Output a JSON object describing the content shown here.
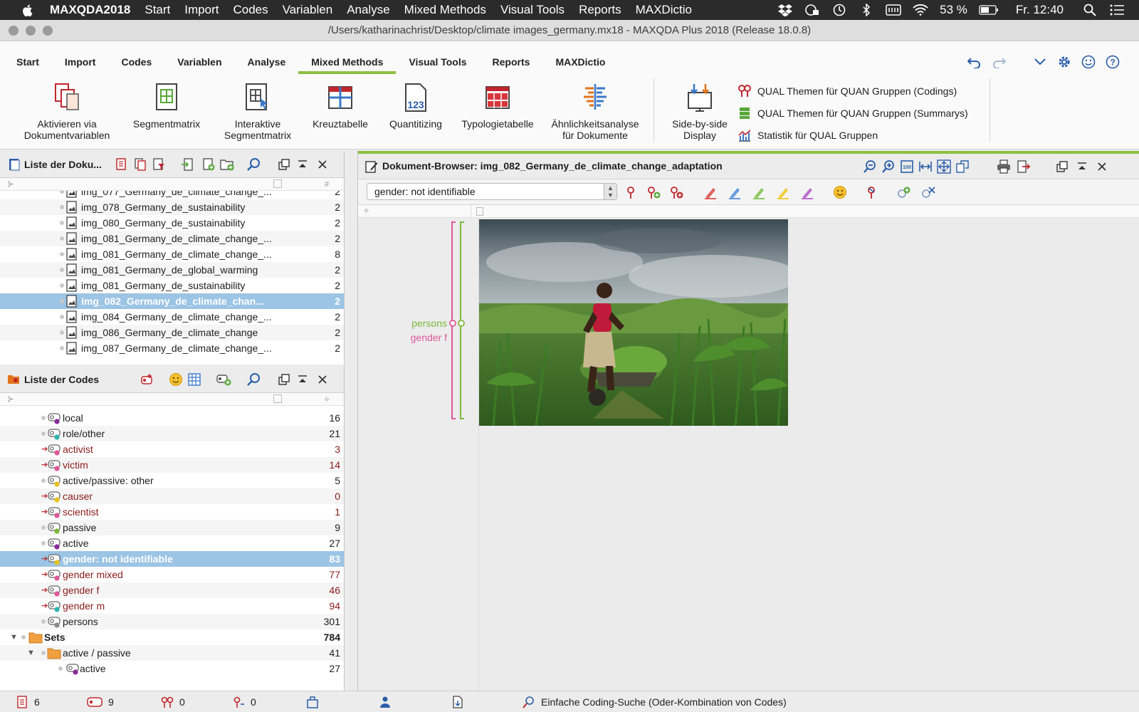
{
  "menubar": {
    "items": [
      "MAXQDA2018",
      "Start",
      "Import",
      "Codes",
      "Variablen",
      "Analyse",
      "Mixed Methods",
      "Visual Tools",
      "Reports",
      "MAXDictio"
    ],
    "battery": "53 %",
    "clock": "Fr. 12:40"
  },
  "window": {
    "title": "/Users/katharinachrist/Desktop/climate images_germany.mx18 - MAXQDA Plus 2018  (Release 18.0.8)"
  },
  "ribbon": {
    "tabs": [
      "Start",
      "Import",
      "Codes",
      "Variablen",
      "Analyse",
      "Mixed Methods",
      "Visual Tools",
      "Reports",
      "MAXDictio"
    ],
    "active_tab": "Mixed Methods",
    "buttons": [
      {
        "label": "Aktivieren via\nDokumentvariablen",
        "icon": "activate-documents-icon"
      },
      {
        "label": "Segmentmatrix",
        "icon": "segment-matrix-icon"
      },
      {
        "label": "Interaktive\nSegmentmatrix",
        "icon": "interactive-segment-matrix-icon"
      },
      {
        "label": "Kreuztabelle",
        "icon": "crosstab-icon"
      },
      {
        "label": "Quantitizing",
        "icon": "quantitizing-icon"
      },
      {
        "label": "Typologietabelle",
        "icon": "typology-table-icon"
      },
      {
        "label": "Ähnlichkeitsanalyse\nfür Dokumente",
        "icon": "similarity-analysis-icon"
      },
      {
        "label": "Side-by-side\nDisplay",
        "icon": "side-by-side-icon"
      }
    ],
    "list_items": [
      {
        "label": "QUAL Themen für QUAN Gruppen (Codings)",
        "icon": "codings-icon"
      },
      {
        "label": "QUAL Themen für QUAN Gruppen (Summarys)",
        "icon": "summaries-icon"
      },
      {
        "label": "Statistik für QUAL Gruppen",
        "icon": "statistics-icon"
      }
    ]
  },
  "documents_panel": {
    "title": "Liste der Doku...",
    "col_count_symbol": "#",
    "rows": [
      {
        "name": "img_077_Germany_de_climate_change_...",
        "count": "2"
      },
      {
        "name": "img_078_Germany_de_sustainability",
        "count": "2"
      },
      {
        "name": "img_080_Germany_de_sustainability",
        "count": "2"
      },
      {
        "name": "img_081_Germany_de_climate_change_...",
        "count": "2"
      },
      {
        "name": "img_081_Germany_de_climate_change_...",
        "count": "8"
      },
      {
        "name": "img_081_Germany_de_global_warming",
        "count": "2"
      },
      {
        "name": "img_081_Germany_de_sustainability",
        "count": "2"
      },
      {
        "name": "img_082_Germany_de_climate_chan...",
        "count": "2",
        "selected": true
      },
      {
        "name": "img_084_Germany_de_climate_change_...",
        "count": "2"
      },
      {
        "name": "img_086_Germany_de_climate_change",
        "count": "2"
      },
      {
        "name": "img_087_Germany_de_climate_change_...",
        "count": "2"
      }
    ]
  },
  "codes_panel": {
    "title": "Liste der Codes",
    "rows": [
      {
        "name": "local",
        "count": "16",
        "color": "#8a2a9a",
        "red": false
      },
      {
        "name": "role/other",
        "count": "21",
        "color": "#2cb5b0",
        "red": false
      },
      {
        "name": "activist",
        "count": "3",
        "color": "#e0569a",
        "red": true
      },
      {
        "name": "victim",
        "count": "14",
        "color": "#e0569a",
        "red": true
      },
      {
        "name": "active/passive: other",
        "count": "5",
        "color": "#e8c21a",
        "red": false
      },
      {
        "name": "causer",
        "count": "0",
        "color": "#e8c21a",
        "red": true
      },
      {
        "name": "scientist",
        "count": "1",
        "color": "#e0569a",
        "red": true
      },
      {
        "name": "passive",
        "count": "9",
        "color": "#7ab83a",
        "red": false
      },
      {
        "name": "active",
        "count": "27",
        "color": "#8a2a9a",
        "red": false
      },
      {
        "name": "gender: not identifiable",
        "count": "83",
        "color": "#e8c21a",
        "red": true,
        "selected": true
      },
      {
        "name": "gender mixed",
        "count": "77",
        "color": "#e0569a",
        "red": true
      },
      {
        "name": "gender f",
        "count": "46",
        "color": "#e0569a",
        "red": true
      },
      {
        "name": "gender m",
        "count": "94",
        "color": "#2cb5b0",
        "red": true
      },
      {
        "name": "persons",
        "count": "301",
        "color": "#8a8a8a",
        "red": false
      }
    ],
    "sets": {
      "name": "Sets",
      "count": "784"
    },
    "set_group": {
      "name": "active / passive",
      "count": "41"
    },
    "set_child": {
      "name": "active",
      "count": "27"
    }
  },
  "document_browser": {
    "title": "Dokument-Browser: img_082_Germany_de_climate_change_adaptation",
    "code_select": "gender: not identifiable",
    "coding_labels": [
      {
        "text": "persons",
        "color": "#7ab83a"
      },
      {
        "text": "gender f",
        "color": "#e0569a"
      }
    ]
  },
  "statusbar": {
    "documents": "6",
    "codes": "9",
    "memos": "0",
    "variables": "0",
    "search": "Einfache Coding-Suche (Oder-Kombination von Codes)"
  }
}
